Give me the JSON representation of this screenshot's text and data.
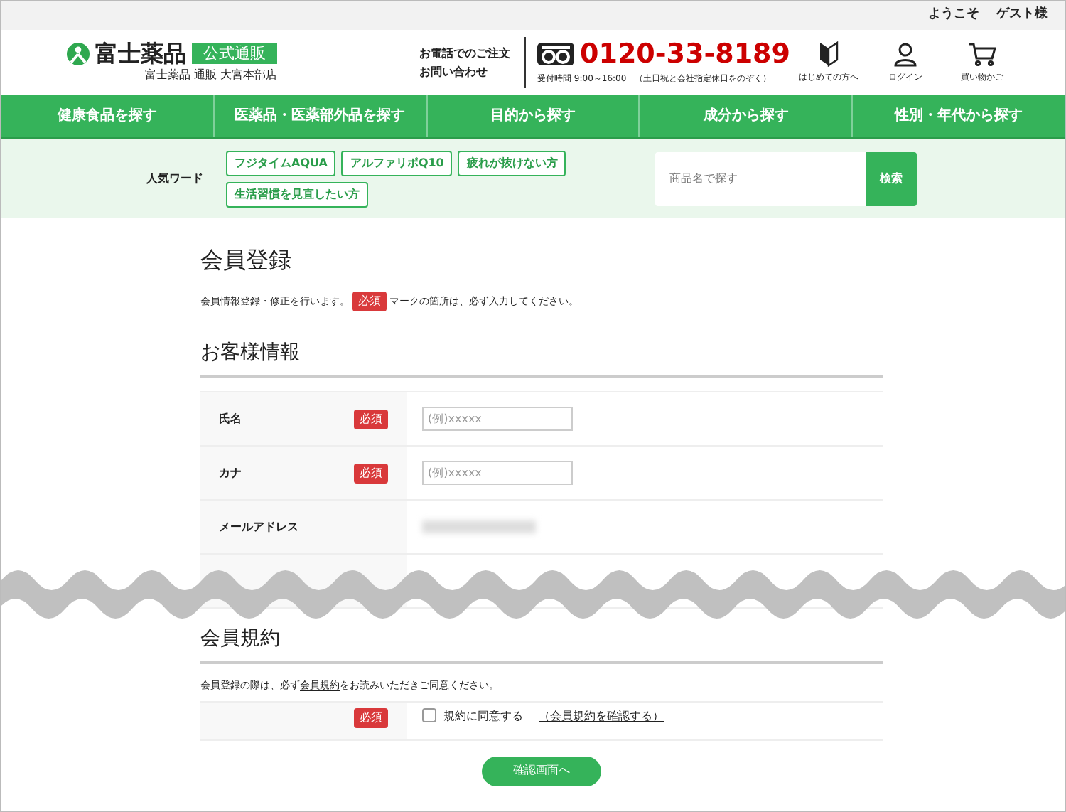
{
  "top_bar": {
    "greeting": "ようこそ",
    "user": "ゲスト様"
  },
  "header": {
    "logo_text": "富士薬品",
    "logo_badge": "公式通販",
    "store_name": "富士薬品 通販 大宮本部店",
    "phone_label_1": "お電話でのご注文",
    "phone_label_2": "お問い合わせ",
    "phone_number": "0120-33-8189",
    "hours": "受付時間 9:00～16:00　（土日祝と会社指定休日をのぞく）",
    "icons": [
      {
        "kind": "beginner",
        "label": "はじめての方へ"
      },
      {
        "kind": "user",
        "label": "ログイン"
      },
      {
        "kind": "cart",
        "label": "買い物かご"
      }
    ]
  },
  "nav": [
    "健康食品を探す",
    "医薬品・医薬部外品を探す",
    "目的から探す",
    "成分から探す",
    "性別・年代から探す"
  ],
  "popular": {
    "label": "人気ワード",
    "tags": [
      "フジタイムAQUA",
      "アルファリポQ10",
      "疲れが抜けない方",
      "生活習慣を見直したい方"
    ],
    "search_placeholder": "商品名で探す",
    "search_button": "検索"
  },
  "page_title": "会員登録",
  "intro": {
    "before": "会員情報登録・修正を行います。",
    "badge": "必須",
    "after": "マークの箇所は、必ず入力してください。"
  },
  "customer_section": {
    "title": "お客様情報",
    "rows": [
      {
        "kind": "input",
        "label": "氏名",
        "required_badge": "必須",
        "placeholder": "(例)xxxxx"
      },
      {
        "kind": "input",
        "label": "カナ",
        "required_badge": "必須",
        "placeholder": "(例)xxxxx"
      },
      {
        "kind": "blurred",
        "label": "メールアドレス"
      },
      {
        "kind": "hidden"
      }
    ]
  },
  "terms_section": {
    "title": "会員規約",
    "text_before": "会員登録の際は、必ず",
    "text_link": "会員規約",
    "text_after": "をお読みいただきご同意ください。",
    "required_badge": "必須",
    "agree_label": "規約に同意する",
    "agree_checked": false,
    "confirm_link": "（会員規約を確認する）"
  },
  "submit_button": "確認画面へ"
}
